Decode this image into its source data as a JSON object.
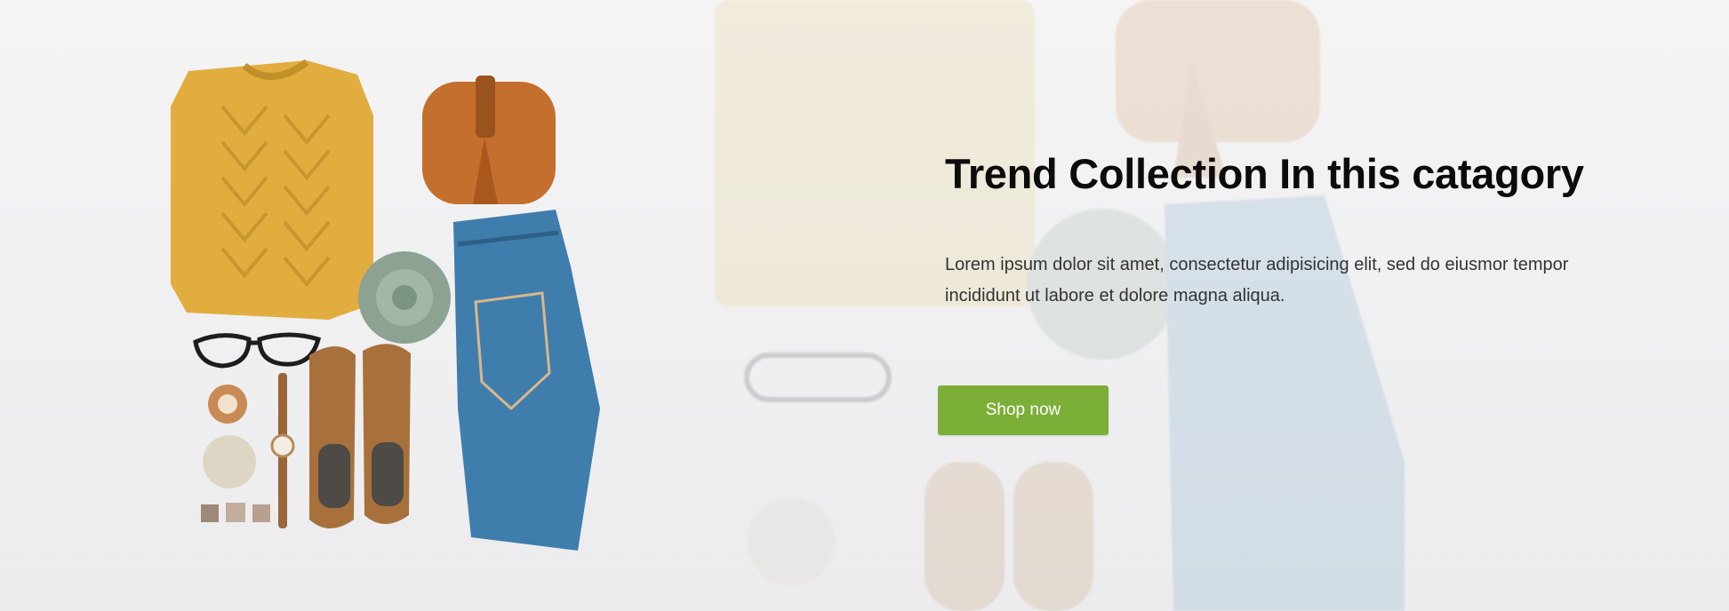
{
  "hero": {
    "title": "Trend Collection In this catagory",
    "description": "Lorem ipsum dolor sit amet, consectetur adipisicing elit, sed do eiusmor tempor incididunt ut labore et  dolore magna aliqua.",
    "button_label": "Shop now"
  },
  "colors": {
    "accent": "#7caf37",
    "sweater": "#e0ac3d",
    "bag": "#c06d2e",
    "jeans": "#3f7cab",
    "shoes": "#a8713b",
    "succulent": "#8aa091"
  },
  "image_items": [
    "sweater",
    "handbag",
    "succulent",
    "jeans",
    "glasses",
    "watch",
    "shoes",
    "dish",
    "rings"
  ]
}
